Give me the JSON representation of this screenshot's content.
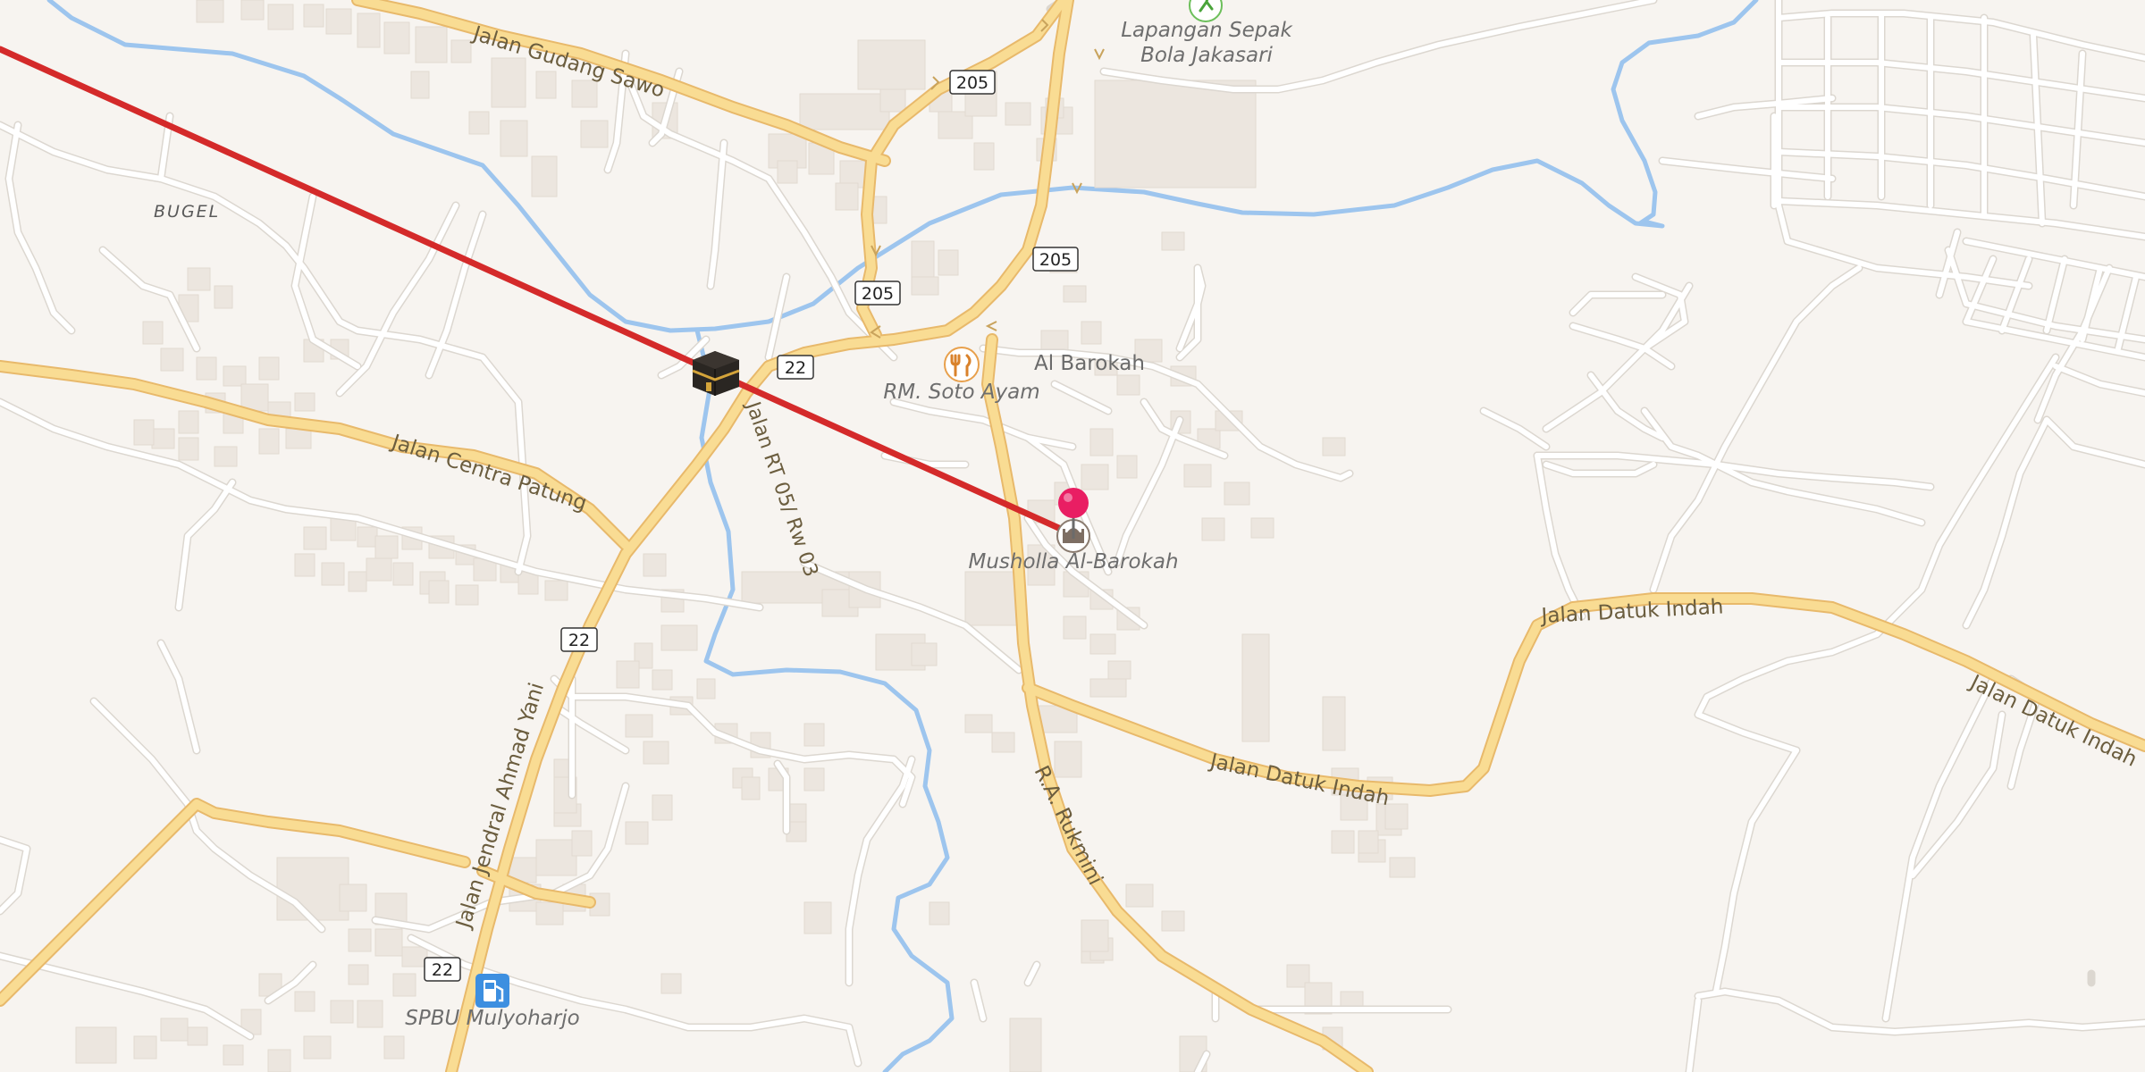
{
  "map": {
    "colors": {
      "land": "#f7f4f0",
      "minor_road": "#ffffff",
      "minor_road_casing": "#dcd7d0",
      "major_road": "#f9dc93",
      "major_road_casing": "#e8b96b",
      "water": "#9dc5ee",
      "building": "#ece6df",
      "route_line": "#d42a2a",
      "pin": "#e91e63",
      "fuel_icon": "#3d8fe0"
    },
    "area_labels": {
      "bugel": "BUGEL"
    },
    "road_labels": {
      "gudang_sawo": "Jalan Gudang Sawo",
      "centra_patung": "Jalan Centra Patung",
      "ahmad_yani": "Jalan Jendral Ahmad Yani",
      "rt05": "Jalan RT 05/ Rw 03",
      "rukmini": "R.A. Rukmini",
      "datuk_indah_1": "Jalan Datuk Indah",
      "datuk_indah_2": "Jalan Datuk Indah",
      "datuk_indah_3": "Jalan Datuk Indah"
    },
    "place_labels": {
      "al_barokah": "Al Barokah"
    },
    "shields": {
      "s205_a": "205",
      "s205_b": "205",
      "s205_c": "205",
      "s22_a": "22",
      "s22_b": "22",
      "s22_c": "22"
    },
    "pois": {
      "lapangan_line1": "Lapangan Sepak",
      "lapangan_line2": "Bola Jakasari",
      "soto_ayam": "RM. Soto Ayam",
      "musholla": "Musholla Al-Barokah",
      "spbu": "SPBU Mulyoharjo"
    },
    "icons": {
      "kaaba": "kaaba-icon",
      "pin": "location-pin-icon",
      "mosque": "mosque-icon",
      "restaurant": "restaurant-icon",
      "fuel": "fuel-station-icon",
      "sports": "sports-field-icon"
    }
  }
}
